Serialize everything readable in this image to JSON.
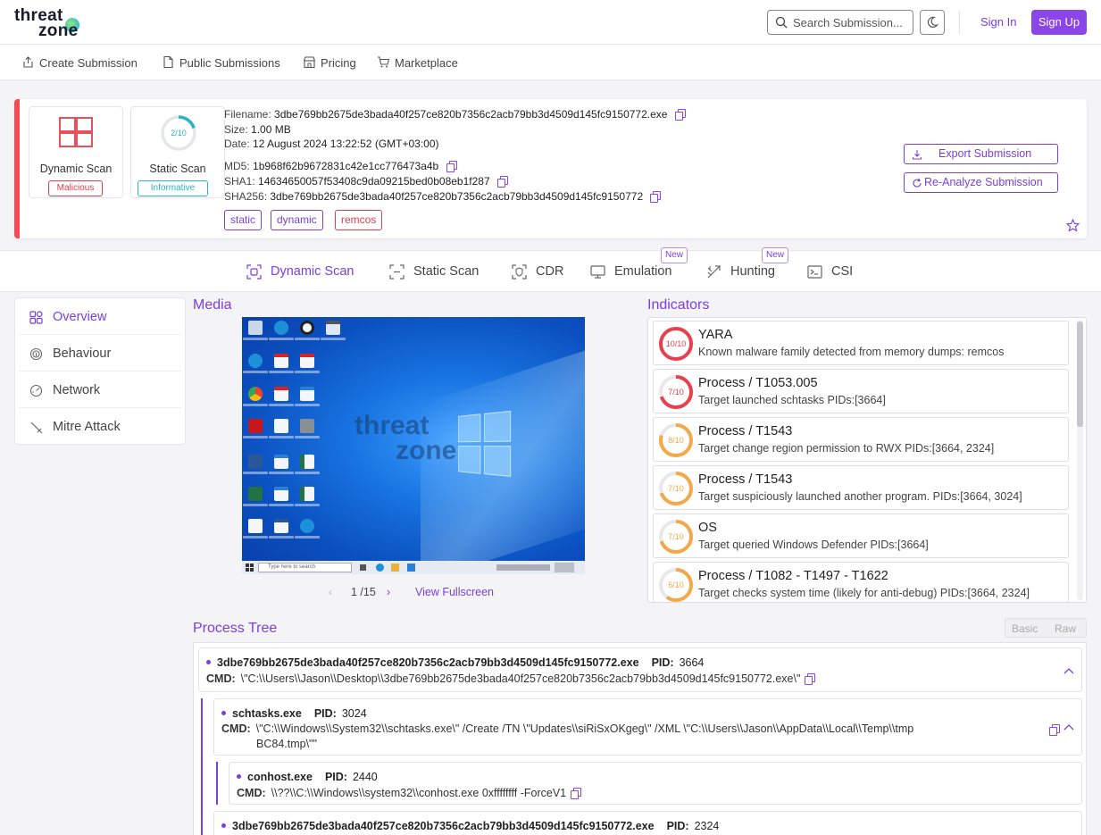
{
  "brand": {
    "line1": "threat",
    "line2": "zone"
  },
  "header": {
    "search_placeholder": "Search Submission...",
    "signin": "Sign In",
    "signup": "Sign Up"
  },
  "nav": {
    "create": "Create Submission",
    "public": "Public Submissions",
    "pricing": "Pricing",
    "marketplace": "Marketplace"
  },
  "submission": {
    "dynamic_label": "Dynamic Scan",
    "dynamic_badge": "Malicious",
    "static_label": "Static Scan",
    "static_badge": "Informative",
    "static_score": "2/10",
    "filename_key": "Filename:",
    "filename": "3dbe769bb2675de3bada40f257ce820b7356c2acb79bb3d4509d145fc9150772.exe",
    "size_key": "Size:",
    "size": "1.00 MB",
    "date_key": "Date:",
    "date": "12 August 2024 13:22:52 (GMT+03:00)",
    "md5_key": "MD5:",
    "md5": "1b968f62b9672831c42e1cc776473a4b",
    "sha1_key": "SHA1:",
    "sha1": "14634650057f53408c9da09215bed0b08eb1f287",
    "sha256_key": "SHA256:",
    "sha256": "3dbe769bb2675de3bada40f257ce820b7356c2acb79bb3d4509d145fc9150772",
    "tags": [
      "static",
      "dynamic",
      "remcos"
    ],
    "export": "Export Submission",
    "reanalyze": "Re-Analyze Submission"
  },
  "tabs": {
    "dynamic": "Dynamic Scan",
    "static": "Static Scan",
    "cdr": "CDR",
    "emulation": "Emulation",
    "hunting": "Hunting",
    "csi": "CSI",
    "new_badge": "New"
  },
  "sidemenu": {
    "overview": "Overview",
    "behaviour": "Behaviour",
    "network": "Network",
    "mitre": "Mitre Attack"
  },
  "media": {
    "title": "Media",
    "page": "1 /15",
    "fullscreen": "View Fullscreen",
    "taskbar_search": "Type here to search"
  },
  "indicators": {
    "title": "Indicators",
    "items": [
      {
        "score": "10/10",
        "level": 1.0,
        "color": "#e8404e",
        "title": "YARA",
        "desc": "Known malware family detected from memory dumps: remcos"
      },
      {
        "score": "7/10",
        "level": 0.7,
        "color": "#e8404e",
        "title": "Process / T1053.005",
        "desc": "Target launched schtasks PIDs:[3664]"
      },
      {
        "score": "8/10",
        "level": 0.8,
        "color": "#f2a94a",
        "title": "Process / T1543",
        "desc": "Target change region permission to RWX PIDs:[3664, 2324]"
      },
      {
        "score": "7/10",
        "level": 0.7,
        "color": "#f2a94a",
        "title": "Process / T1543",
        "desc": "Target suspiciously launched another program. PIDs:[3664, 3024]"
      },
      {
        "score": "7/10",
        "level": 0.7,
        "color": "#f2a94a",
        "title": "OS",
        "desc": "Target queried Windows Defender PIDs:[3664]"
      },
      {
        "score": "6/10",
        "level": 0.6,
        "color": "#f2a94a",
        "title": "Process / T1082 - T1497 - T1622",
        "desc": "Target checks system time (likely for anti-debug) PIDs:[3664, 2324]"
      }
    ]
  },
  "process_tree": {
    "title": "Process Tree",
    "basic": "Basic",
    "raw": "Raw",
    "pid_key": "PID:",
    "cmd_key": "CMD:",
    "nodes": [
      {
        "name": "3dbe769bb2675de3bada40f257ce820b7356c2acb79bb3d4509d145fc9150772.exe",
        "pid": "3664",
        "cmd": "\\\"C:\\\\Users\\\\Jason\\\\Desktop\\\\3dbe769bb2675de3bada40f257ce820b7356c2acb79bb3d4509d145fc9150772.exe\\\""
      },
      {
        "name": "schtasks.exe",
        "pid": "3024",
        "cmd": "\\\"C:\\\\Windows\\\\System32\\\\schtasks.exe\\\" /Create /TN \\\"Updates\\\\siRiSxOKgeg\\\" /XML \\\"C:\\\\Users\\\\Jason\\\\AppData\\\\Local\\\\Temp\\\\tmp",
        "cmd2": "BC84.tmp\\\"\""
      },
      {
        "name": "conhost.exe",
        "pid": "2440",
        "cmd": "\\\\??\\\\C:\\\\Windows\\\\system32\\\\conhost.exe 0xffffffff -ForceV1"
      },
      {
        "name": "3dbe769bb2675de3bada40f257ce820b7356c2acb79bb3d4509d145fc9150772.exe",
        "pid": "2324"
      }
    ]
  }
}
